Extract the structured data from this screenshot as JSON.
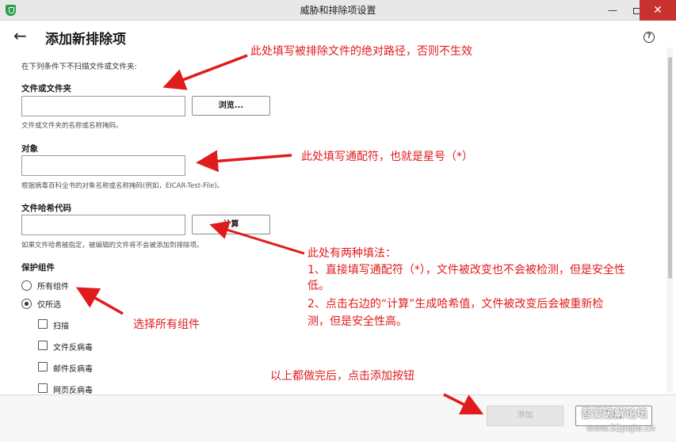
{
  "window": {
    "title": "威胁和排除项设置",
    "minimize_label": "—",
    "close_label": "✕"
  },
  "header": {
    "back_label": "←",
    "title": "添加新排除项",
    "help_label": "?"
  },
  "form": {
    "intro": "在下列条件下不扫描文件或文件夹:",
    "file_folder": {
      "label": "文件或文件夹",
      "value": "",
      "browse_label": "浏览...",
      "hint": "文件或文件夹的名称或名称掩码。"
    },
    "object": {
      "label": "对象",
      "value": "",
      "hint": "根据病毒百科全书的对象名称或名称掩码(例如，EICAR-Test-File)。"
    },
    "hash": {
      "label": "文件哈希代码",
      "value": "",
      "compute_label": "计算",
      "hint": "如果文件哈希被指定，被编辑的文件将不会被添加到排除项。"
    },
    "protection": {
      "label": "保护组件",
      "options": [
        {
          "label": "所有组件",
          "selected": false
        },
        {
          "label": "仅所选",
          "selected": true
        }
      ],
      "components": [
        {
          "label": "扫描",
          "checked": false
        },
        {
          "label": "文件反病毒",
          "checked": false
        },
        {
          "label": "邮件反病毒",
          "checked": false
        },
        {
          "label": "网页反病毒",
          "checked": false
        }
      ]
    }
  },
  "footer": {
    "add_label": "添加",
    "cancel_label": "取消"
  },
  "annotations": {
    "a1": "此处填写被排除文件的绝对路径，否则不生效",
    "a2": "此处填写通配符，也就是星号（*）",
    "a3_title": "此处有两种填法：",
    "a3_line1a": "1、直接填写通配符（*），文件被改变也不会被检测，但是安全性",
    "a3_line1b": "低。",
    "a3_line2a": "2、点击右边的“计算”生成哈希值，文件被改变后会被重新检",
    "a3_line2b": "测，但是安全性高。",
    "a4": "选择所有组件",
    "a5": "以上都做完后，点击添加按钮"
  },
  "watermark": {
    "line1": "吾爱破解论坛",
    "line2": "www.52pojie.cn"
  },
  "colors": {
    "annotation": "#e01b1b",
    "close_button": "#c7312e",
    "app_icon": "#2e9e4e"
  }
}
